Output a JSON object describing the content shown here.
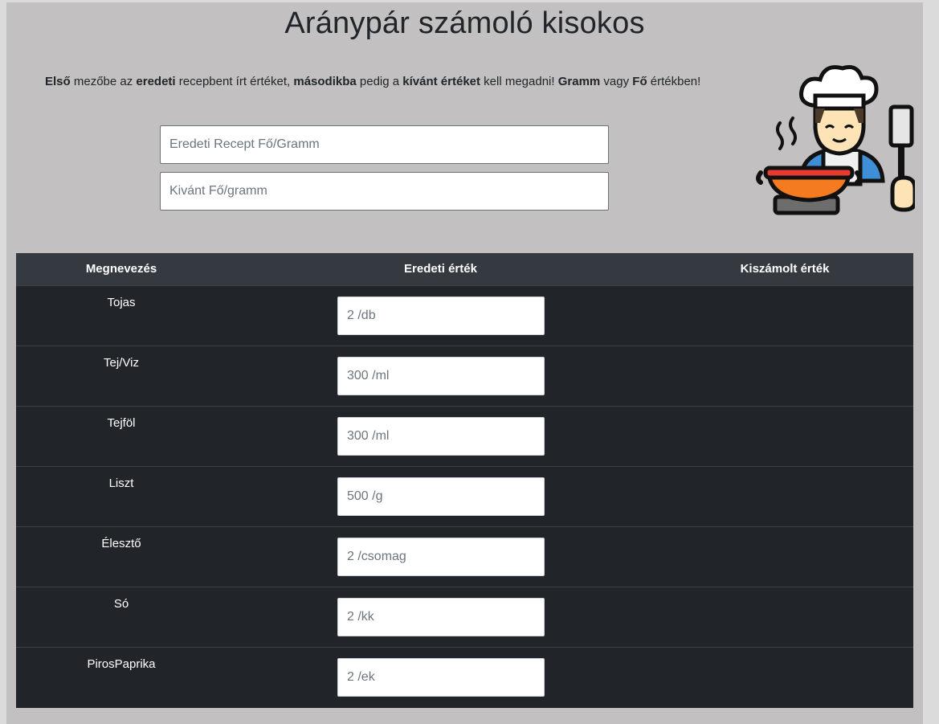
{
  "page": {
    "title": "Aránypár számoló kisokos"
  },
  "instructions": [
    {
      "text": "Első",
      "bold": true
    },
    {
      "text": " mezőbe az ",
      "bold": false
    },
    {
      "text": "eredeti",
      "bold": true
    },
    {
      "text": " recepbent írt értéket, ",
      "bold": false
    },
    {
      "text": "másodikba",
      "bold": true
    },
    {
      "text": " pedig a ",
      "bold": false
    },
    {
      "text": "kívánt értéket",
      "bold": true
    },
    {
      "text": " kell megadni! ",
      "bold": false
    },
    {
      "text": "Gramm",
      "bold": true
    },
    {
      "text": " vagy ",
      "bold": false
    },
    {
      "text": "Fő",
      "bold": true
    },
    {
      "text": " értékben!",
      "bold": false
    }
  ],
  "inputs": {
    "original_placeholder": "Eredeti Recept Fő/Gramm",
    "target_placeholder": "Kivánt Fő/gramm"
  },
  "chef_image": "chef-cooking-illustration",
  "table": {
    "headers": {
      "name": "Megnevezés",
      "original": "Eredeti érték",
      "calculated": "Kiszámolt érték"
    },
    "rows": [
      {
        "name": "Tojas",
        "placeholder": "2 /db",
        "calculated": ""
      },
      {
        "name": "Tej/Viz",
        "placeholder": "300 /ml",
        "calculated": ""
      },
      {
        "name": "Tejföl",
        "placeholder": "300 /ml",
        "calculated": ""
      },
      {
        "name": "Liszt",
        "placeholder": "500 /g",
        "calculated": ""
      },
      {
        "name": "Élesztő",
        "placeholder": "2 /csomag",
        "calculated": ""
      },
      {
        "name": "Só",
        "placeholder": "2 /kk",
        "calculated": ""
      },
      {
        "name": "PirosPaprika",
        "placeholder": "2 /ek",
        "calculated": ""
      }
    ]
  },
  "colors": {
    "page_bg": "#dcdbdb",
    "panel_bg": "#c2c0c0",
    "table_bg": "#212529",
    "table_head_bg": "#343a40"
  }
}
